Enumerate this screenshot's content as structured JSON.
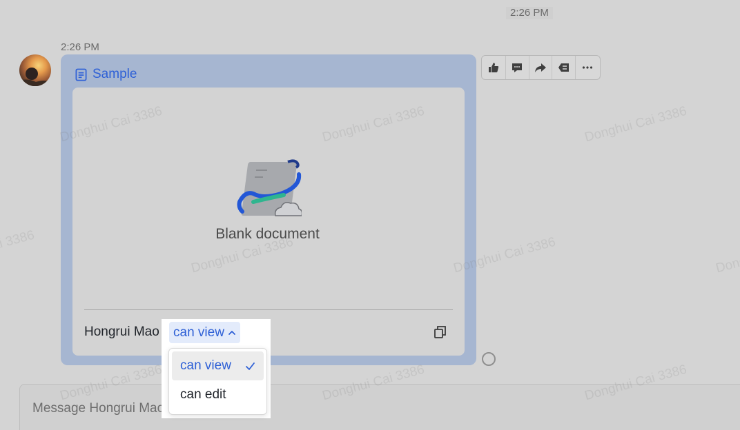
{
  "chat": {
    "top_timestamp": "2:26 PM",
    "message_timestamp": "2:26 PM",
    "composer_placeholder": "Message Hongrui Mao"
  },
  "doc_card": {
    "title": "Sample",
    "preview_label": "Blank document",
    "owner_name": "Hongrui Mao",
    "permission_value": "can view",
    "permission_options": [
      "can view",
      "can edit"
    ],
    "selected_option": "can view"
  },
  "watermark_text": "Donghui Cai 3386",
  "toolbar": {
    "icons": [
      "thumbs-up-icon",
      "comment-icon",
      "forward-icon",
      "quote-reply-icon",
      "more-icon"
    ]
  },
  "colors": {
    "accent": "#2e60d6",
    "card_bg": "#a6b6d1",
    "page_bg": "#d4d4d4"
  }
}
